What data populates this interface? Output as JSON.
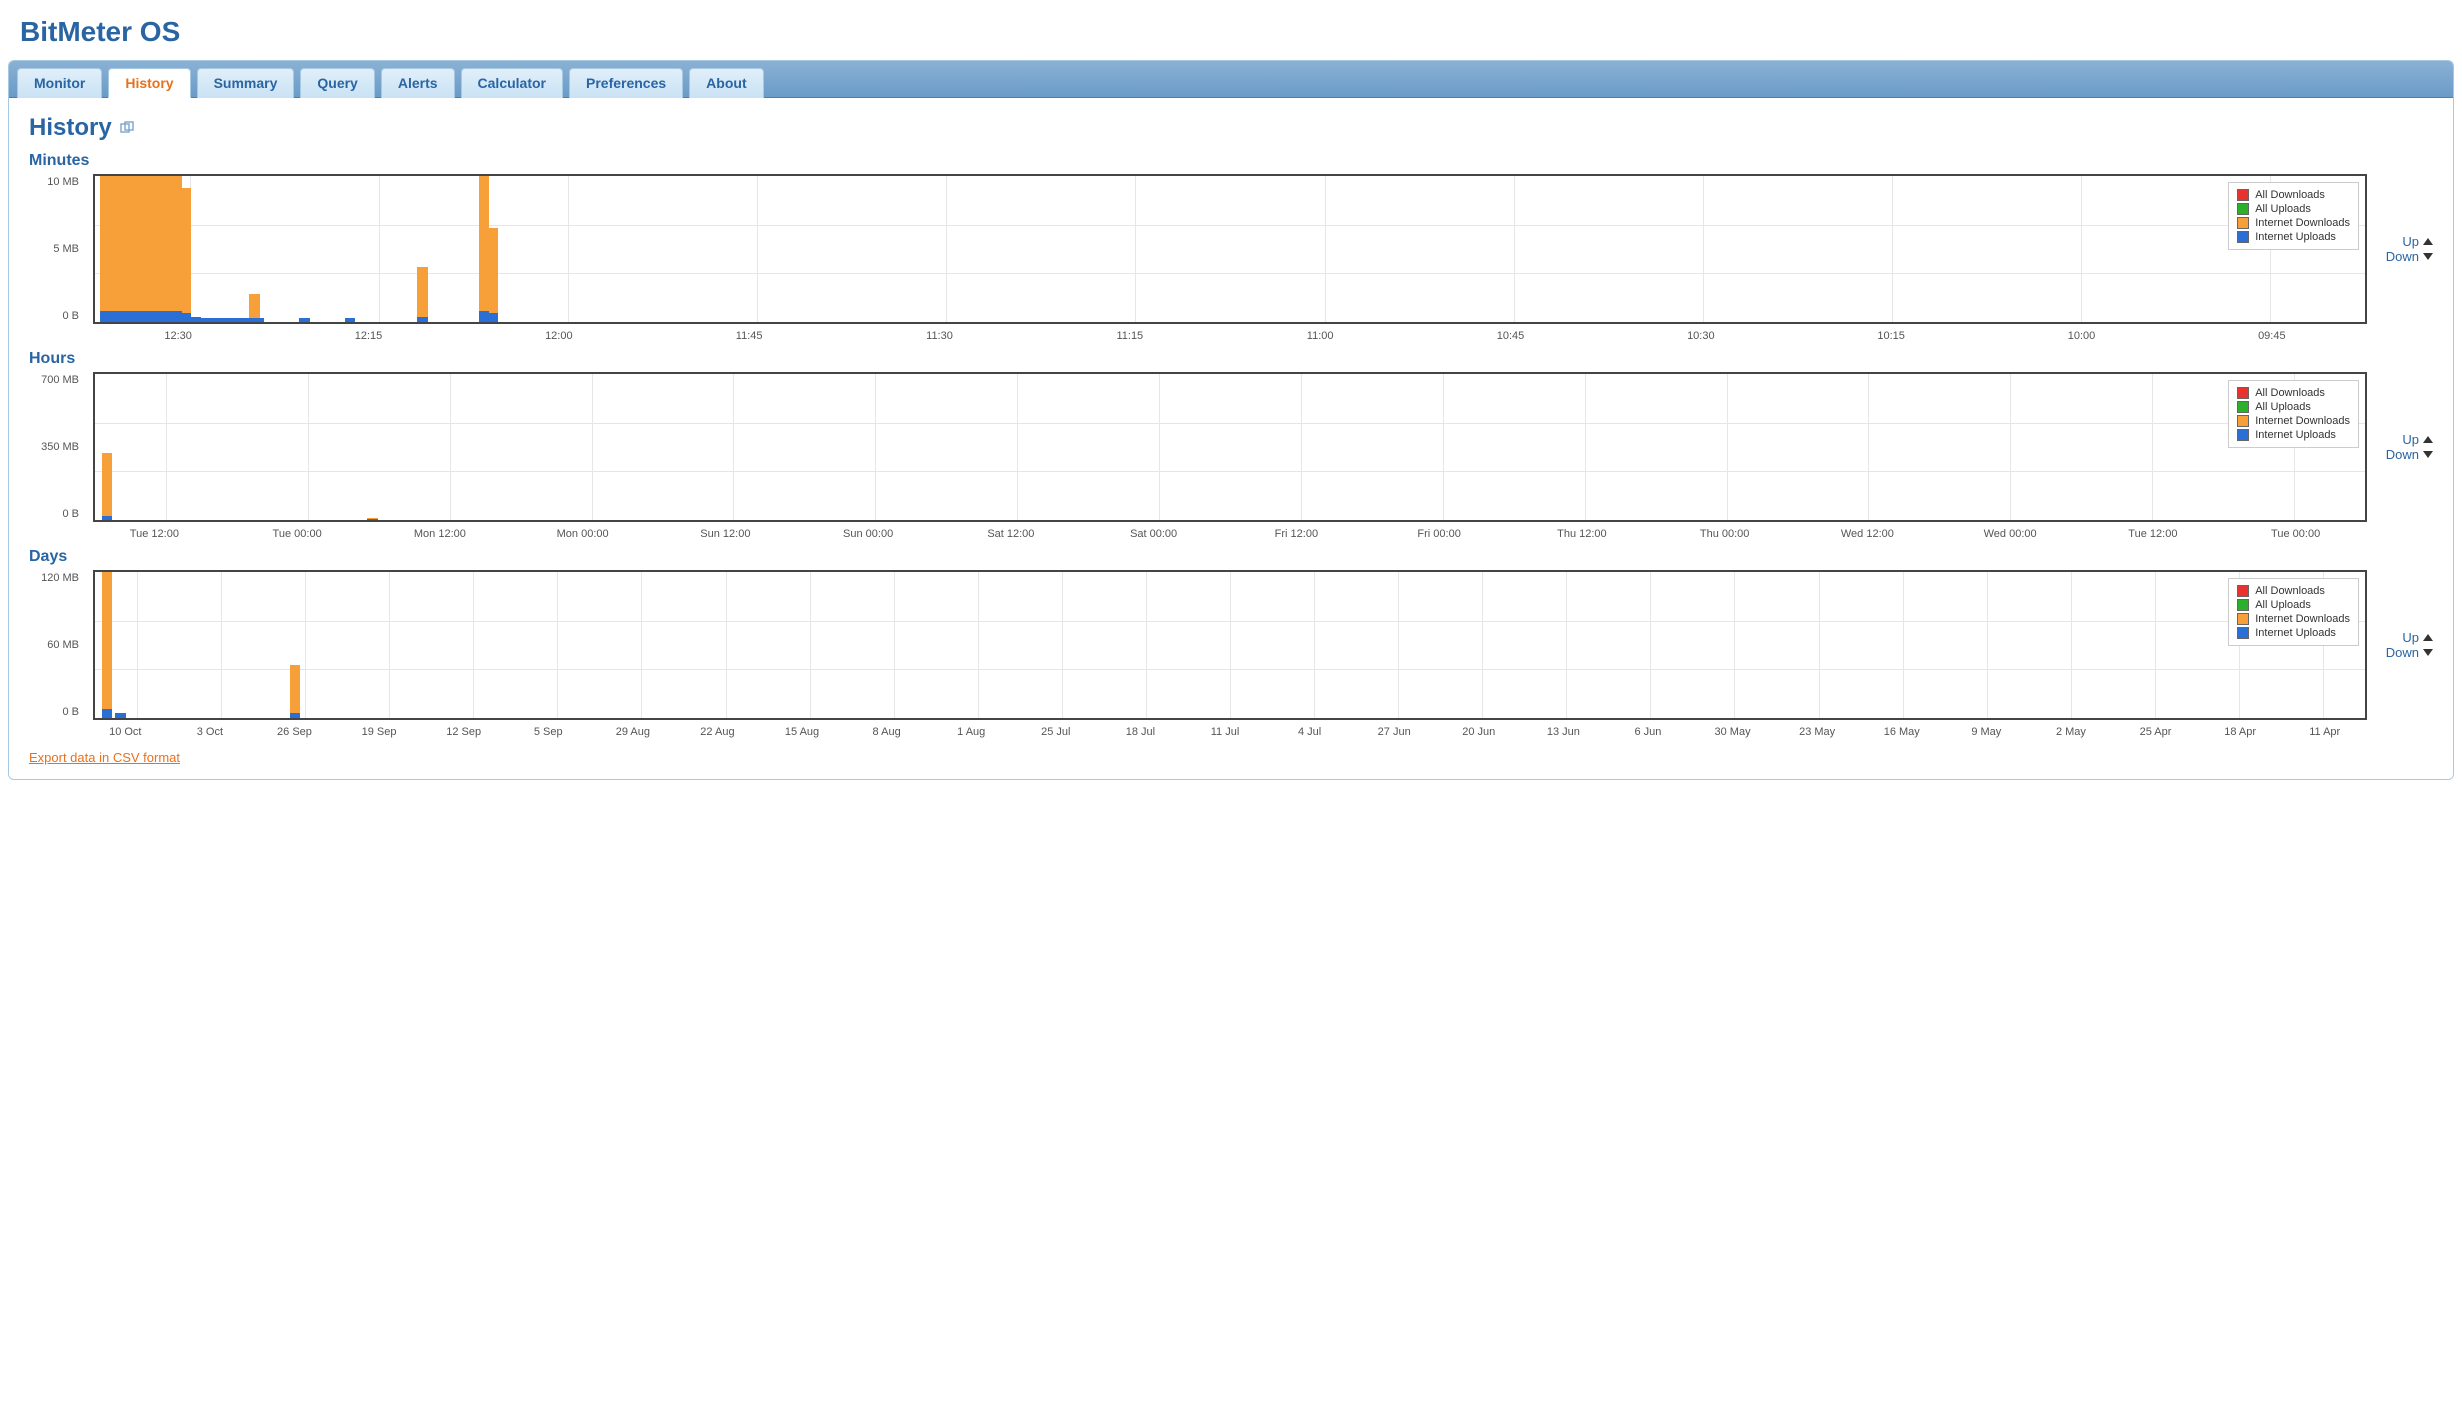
{
  "app": {
    "title": "BitMeter OS"
  },
  "tabs": [
    {
      "label": "Monitor",
      "active": false
    },
    {
      "label": "History",
      "active": true
    },
    {
      "label": "Summary",
      "active": false
    },
    {
      "label": "Query",
      "active": false
    },
    {
      "label": "Alerts",
      "active": false
    },
    {
      "label": "Calculator",
      "active": false
    },
    {
      "label": "Preferences",
      "active": false
    },
    {
      "label": "About",
      "active": false
    }
  ],
  "page": {
    "heading": "History"
  },
  "legend_items": [
    {
      "label": "All Downloads",
      "color": "#e9322e"
    },
    {
      "label": "All Uploads",
      "color": "#2bb02b"
    },
    {
      "label": "Internet Downloads",
      "color": "#f7a03a"
    },
    {
      "label": "Internet Uploads",
      "color": "#2a6fd6"
    }
  ],
  "buttons": {
    "up": "Up",
    "down": "Down"
  },
  "export_link": "Export data in CSV format",
  "sections": {
    "minutes": {
      "title": "Minutes"
    },
    "hours": {
      "title": "Hours"
    },
    "days": {
      "title": "Days"
    }
  },
  "chart_data": [
    {
      "id": "minutes",
      "type": "bar",
      "ylabel": "",
      "ylim": [
        0,
        12
      ],
      "y_ticks": [
        "10 MB",
        "5 MB",
        "0 B"
      ],
      "x_ticks": [
        "12:30",
        "12:15",
        "12:00",
        "11:45",
        "11:30",
        "11:15",
        "11:00",
        "10:45",
        "10:30",
        "10:15",
        "10:00",
        "09:45"
      ],
      "series": [
        {
          "name": "Internet Downloads",
          "color": "#f7a03a",
          "bars": [
            {
              "x_pct": 0.2,
              "mb": 12.0
            },
            {
              "x_pct": 0.6,
              "mb": 12.0
            },
            {
              "x_pct": 1.0,
              "mb": 12.0
            },
            {
              "x_pct": 1.4,
              "mb": 12.0
            },
            {
              "x_pct": 1.8,
              "mb": 12.0
            },
            {
              "x_pct": 2.2,
              "mb": 12.0
            },
            {
              "x_pct": 2.6,
              "mb": 12.0
            },
            {
              "x_pct": 3.0,
              "mb": 12.0
            },
            {
              "x_pct": 3.4,
              "mb": 12.0
            },
            {
              "x_pct": 3.8,
              "mb": 11.0
            },
            {
              "x_pct": 6.8,
              "mb": 2.3
            },
            {
              "x_pct": 14.2,
              "mb": 4.5
            },
            {
              "x_pct": 16.9,
              "mb": 12.0
            },
            {
              "x_pct": 17.3,
              "mb": 7.7
            }
          ]
        },
        {
          "name": "Internet Uploads",
          "color": "#2a6fd6",
          "bars": [
            {
              "x_pct": 0.2,
              "mb": 0.9
            },
            {
              "x_pct": 0.6,
              "mb": 0.9
            },
            {
              "x_pct": 1.0,
              "mb": 0.9
            },
            {
              "x_pct": 1.4,
              "mb": 0.9
            },
            {
              "x_pct": 1.8,
              "mb": 0.9
            },
            {
              "x_pct": 2.2,
              "mb": 0.9
            },
            {
              "x_pct": 2.6,
              "mb": 0.9
            },
            {
              "x_pct": 3.0,
              "mb": 0.9
            },
            {
              "x_pct": 3.4,
              "mb": 0.9
            },
            {
              "x_pct": 3.8,
              "mb": 0.7
            },
            {
              "x_pct": 4.2,
              "mb": 0.4
            },
            {
              "x_pct": 4.6,
              "mb": 0.3
            },
            {
              "x_pct": 5.0,
              "mb": 0.3
            },
            {
              "x_pct": 5.4,
              "mb": 0.3
            },
            {
              "x_pct": 5.8,
              "mb": 0.3
            },
            {
              "x_pct": 6.2,
              "mb": 0.3
            },
            {
              "x_pct": 6.6,
              "mb": 0.3
            },
            {
              "x_pct": 7.0,
              "mb": 0.3
            },
            {
              "x_pct": 9.0,
              "mb": 0.3
            },
            {
              "x_pct": 11.0,
              "mb": 0.3
            },
            {
              "x_pct": 14.2,
              "mb": 0.4
            },
            {
              "x_pct": 16.9,
              "mb": 0.9
            },
            {
              "x_pct": 17.3,
              "mb": 0.7
            }
          ]
        }
      ]
    },
    {
      "id": "hours",
      "type": "bar",
      "ylim": [
        0,
        700
      ],
      "y_ticks": [
        "700 MB",
        "350 MB",
        "0 B"
      ],
      "x_ticks": [
        "Tue 12:00",
        "Tue 00:00",
        "Mon 12:00",
        "Mon 00:00",
        "Sun 12:00",
        "Sun 00:00",
        "Sat 12:00",
        "Sat 00:00",
        "Fri 12:00",
        "Fri 00:00",
        "Thu 12:00",
        "Thu 00:00",
        "Wed 12:00",
        "Wed 00:00",
        "Tue 12:00",
        "Tue 00:00"
      ],
      "series": [
        {
          "name": "Internet Downloads",
          "color": "#f7a03a",
          "bars": [
            {
              "x_pct": 0.3,
              "mb": 320
            },
            {
              "x_pct": 12.0,
              "mb": 8
            }
          ]
        },
        {
          "name": "Internet Uploads",
          "color": "#2a6fd6",
          "bars": [
            {
              "x_pct": 0.3,
              "mb": 20
            },
            {
              "x_pct": 12.0,
              "mb": 6
            }
          ]
        }
      ]
    },
    {
      "id": "days",
      "type": "bar",
      "ylim": [
        0,
        160
      ],
      "y_ticks": [
        "120 MB",
        "60 MB",
        "0 B"
      ],
      "x_ticks": [
        "10 Oct",
        "3 Oct",
        "26 Sep",
        "19 Sep",
        "12 Sep",
        "5 Sep",
        "29 Aug",
        "22 Aug",
        "15 Aug",
        "8 Aug",
        "1 Aug",
        "25 Jul",
        "18 Jul",
        "11 Jul",
        "4 Jul",
        "27 Jun",
        "20 Jun",
        "13 Jun",
        "6 Jun",
        "30 May",
        "23 May",
        "16 May",
        "9 May",
        "2 May",
        "25 Apr",
        "18 Apr",
        "11 Apr"
      ],
      "series": [
        {
          "name": "Internet Downloads",
          "color": "#f7a03a",
          "bars": [
            {
              "x_pct": 0.3,
              "mb": 160
            },
            {
              "x_pct": 8.6,
              "mb": 58
            }
          ]
        },
        {
          "name": "Internet Uploads",
          "color": "#2a6fd6",
          "bars": [
            {
              "x_pct": 0.3,
              "mb": 10
            },
            {
              "x_pct": 0.9,
              "mb": 6
            },
            {
              "x_pct": 8.6,
              "mb": 6
            }
          ]
        }
      ]
    }
  ]
}
